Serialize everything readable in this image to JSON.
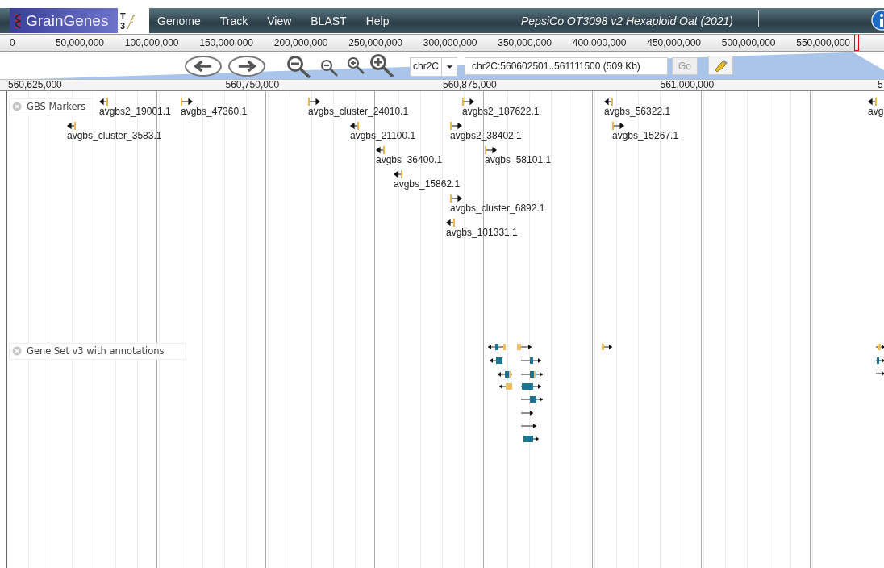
{
  "header": {
    "logo": "GrainGenes",
    "logo_badge": "T3",
    "menu": [
      "Genome",
      "Track",
      "View",
      "BLAST",
      "Help"
    ],
    "title": "PepsiCo OT3098 v2 Hexaploid Oat (2021)"
  },
  "overview": {
    "ticks": [
      "0",
      "50,000,000",
      "100,000,000",
      "150,000,000",
      "200,000,000",
      "250,000,000",
      "300,000,000",
      "350,000,000",
      "400,000,000",
      "450,000,000",
      "500,000,000",
      "550,000,000"
    ]
  },
  "navigation": {
    "chromosome": "chr2C",
    "location": "chr2C:560602501..561111500 (509 Kb)",
    "go": {
      "label": "Go",
      "disabled": true
    }
  },
  "ruler": {
    "ticks": [
      "560,625,000",
      "560,750,000",
      "560,875,000",
      "561,000,000",
      "5"
    ]
  },
  "tracks": [
    {
      "label": "GBS Markers",
      "kind": "markers",
      "features": [
        {
          "name": "avgbs2_19001.1",
          "forward": false
        },
        {
          "name": "avgbs_47360.1",
          "forward": true
        },
        {
          "name": "avgbs_cluster_24010.1",
          "forward": true
        },
        {
          "name": "avgbs2_187622.1",
          "forward": true
        },
        {
          "name": "avgbs_56322.1",
          "forward": false
        },
        {
          "name": "avg",
          "forward": false
        },
        {
          "name": "avgbs_cluster_3583.1",
          "forward": false
        },
        {
          "name": "avgbs_21100.1",
          "forward": false
        },
        {
          "name": "avgbs2_38402.1",
          "forward": true
        },
        {
          "name": "avgbs_15267.1",
          "forward": true
        },
        {
          "name": "avgbs_36400.1",
          "forward": false
        },
        {
          "name": "avgbs_58101.1",
          "forward": true
        },
        {
          "name": "avgbs_15862.1",
          "forward": false
        },
        {
          "name": "avgbs_cluster_6892.1",
          "forward": true
        },
        {
          "name": "avgbs_101331.1",
          "forward": false
        }
      ]
    },
    {
      "label": "Gene Set v3 with annotations",
      "kind": "genes"
    }
  ]
}
